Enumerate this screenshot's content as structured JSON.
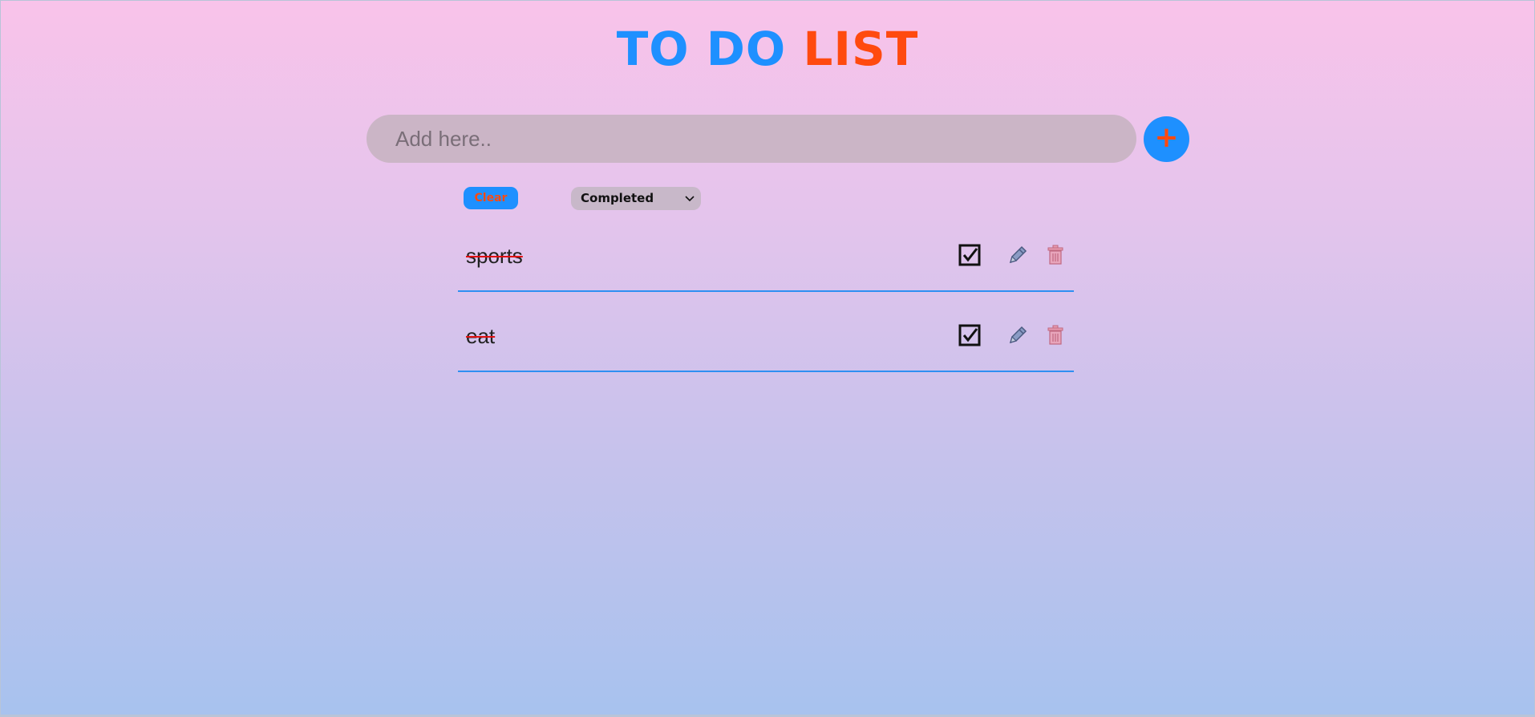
{
  "header": {
    "title_part1": "TO DO",
    "title_part2": "LIST",
    "title_part1_color": "#1e90ff",
    "title_part2_color": "#ff4a0f"
  },
  "add_form": {
    "placeholder": "Add here..",
    "value": "",
    "add_button_icon": "plus-icon",
    "add_button_glyph": "+"
  },
  "controls": {
    "clear_label": "Clear",
    "filter_selected": "Completed"
  },
  "todos": [
    {
      "text": "sports",
      "completed": true,
      "icons": [
        "checkbox-checked-icon",
        "pencil-icon",
        "trash-icon"
      ]
    },
    {
      "text": "eat",
      "completed": true,
      "icons": [
        "checkbox-checked-icon",
        "pencil-icon",
        "trash-icon"
      ]
    }
  ],
  "colors": {
    "accent": "#1e90ff",
    "secondary": "#ff4a0f",
    "strike": "#e01010",
    "divider": "#2f8ff2"
  }
}
